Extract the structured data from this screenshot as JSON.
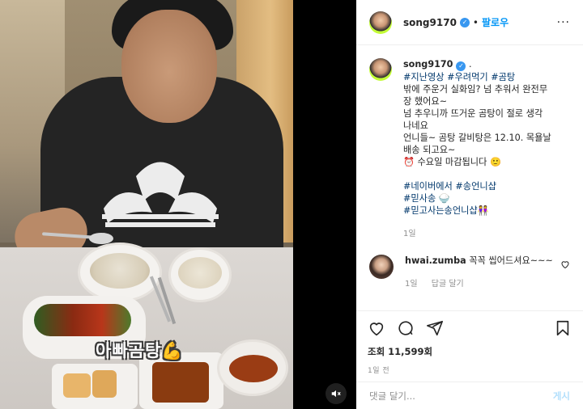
{
  "video": {
    "caption": "아빠곰탕💪",
    "mute_icon": "speaker-muted-icon"
  },
  "header": {
    "username": "song9170",
    "follow_label": "팔로우",
    "separator": "•",
    "more_label": "···"
  },
  "post": {
    "username": "song9170",
    "trailing": ".",
    "line1_tags": [
      "#지난영상",
      "#우려먹기",
      "#곰탕"
    ],
    "lines": [
      "밖에 주운거 실화임? 넘 추워서 완전무",
      "장 했어요~",
      "넘 추우니까 뜨거운 곰탕이 절로 생각",
      "나네요",
      "언니들~ 곰탕 갈비탕은 12.10. 목욜날",
      "배송 되고요~",
      "⏰ 수요일 마감됩니다 🙂"
    ],
    "tag_line1": [
      "#네이버에서",
      "#송언니샵"
    ],
    "tag_line2": "#믿사송 🍚",
    "tag_line3": "#믿고사는송언니샵👭",
    "time": "1일"
  },
  "comment": {
    "username": "hwai.zumba",
    "text": "꼭꼭 씹어드셔요~~~",
    "time": "1일",
    "reply_label": "답글 달기"
  },
  "actions": {
    "views": "조회 11,599회",
    "posted": "1일 전"
  },
  "add_comment": {
    "placeholder": "댓글 달기...",
    "post_label": "게시"
  }
}
